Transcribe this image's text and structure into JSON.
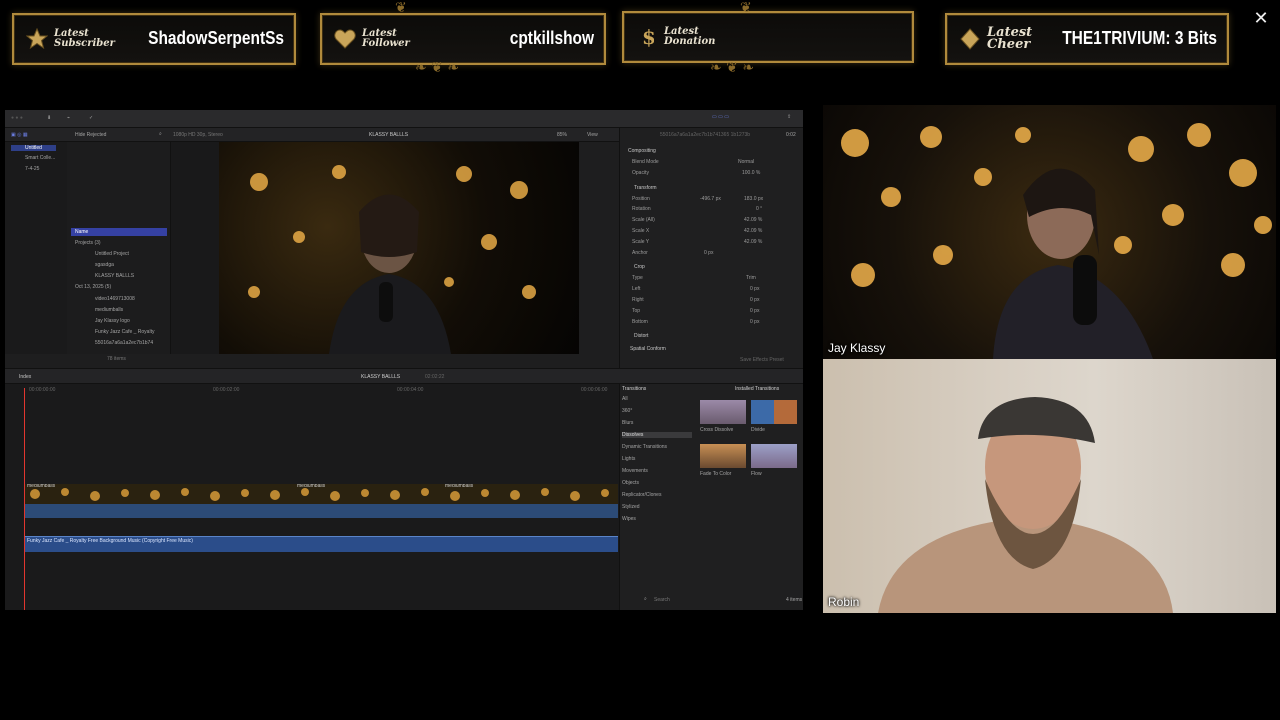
{
  "alerts": {
    "subscriber": {
      "label_line1": "Latest",
      "label_line2": "Subscriber",
      "value": "ShadowSerpentSs"
    },
    "follower": {
      "label_line1": "Latest",
      "label_line2": "Follower",
      "value": "cptkillshow"
    },
    "donation": {
      "label_line1": "Latest",
      "label_line2": "Donation",
      "value": ""
    },
    "cheer": {
      "label_line1": "Latest",
      "label_line2": "Cheer",
      "value": "THE1TRIVIUM: 3 Bits"
    }
  },
  "close_glyph": "✕",
  "accent_gold": "#b08a3c",
  "editor": {
    "toolbar_filter": "Hide Rejected",
    "format": "1080p HD 30p, Stereo",
    "project_title": "KLASSY BALLLS",
    "zoom": "85%",
    "view_label": "View",
    "clip_id": "55016a7a6a1a2ec7b1b741365 1b1273b",
    "timecode_top": "0:02",
    "library": [
      "Untitled",
      "Smart Colle...",
      "7-4-25"
    ],
    "browser_header": "Name",
    "browser_items": [
      "Projects  (3)",
      "Untitled Project",
      "sgasdga",
      "KLASSY BALLLS",
      "Oct 13, 2025  (5)",
      "video1469713008",
      "mediumballs",
      "Jay Klassy logo",
      "Funky Jazz Cafe _ Royalty",
      "55016a7a6a1a2ec7b1b74"
    ],
    "browser_footer": "78 items",
    "inspector": {
      "compositing": "Compositing",
      "blend_mode": "Blend Mode",
      "blend_value": "Normal",
      "opacity": "Opacity",
      "opacity_value": "100.0 %",
      "transform": "Transform",
      "position": "Position",
      "position_x": "-496.7 px",
      "position_y": "183.0 px",
      "rotation": "Rotation",
      "rotation_value": "0 °",
      "scale_all": "Scale (All)",
      "scale_all_value": "42.09 %",
      "scale_x": "Scale X",
      "scale_x_value": "42.09 %",
      "scale_y": "Scale Y",
      "scale_y_value": "42.09 %",
      "anchor": "Anchor",
      "anchor_value": "0 px",
      "crop": "Crop",
      "crop_type": "Type",
      "crop_type_value": "Trim",
      "left": "Left",
      "right": "Right",
      "top": "Top",
      "bottom": "Bottom",
      "px0": "0 px",
      "distort": "Distort",
      "spatial": "Spatial Conform",
      "save_preset": "Save Effects Preset"
    },
    "index_label": "Index",
    "timeline_title": "KLASSY BALLLS",
    "timeline_duration": "02:02:22",
    "ruler": [
      "00:00:00:00",
      "00:00:02:00",
      "00:00:04:00",
      "00:00:06:00"
    ],
    "clip_labels": [
      "mediumballs",
      "mediumballs",
      "mediumballs"
    ],
    "music_label": "Funky Jazz Cafe _ Royalty Free Background Music (Copyright Free Music)",
    "transitions": {
      "title": "Transitions",
      "installed": "Installed Transitions",
      "categories": [
        "All",
        "360°",
        "Blurs",
        "Dissolves",
        "Dynamic Transitions",
        "Lights",
        "Movements",
        "Objects",
        "Replicator/Clones",
        "Stylized",
        "Wipes"
      ],
      "thumbs": [
        "Cross Dissolve",
        "Divide",
        "Fade To Color",
        "Flow"
      ],
      "search": "Search",
      "count": "4 items"
    }
  },
  "cams": {
    "top_name": "Jay Klassy",
    "bottom_name": "Robin"
  }
}
